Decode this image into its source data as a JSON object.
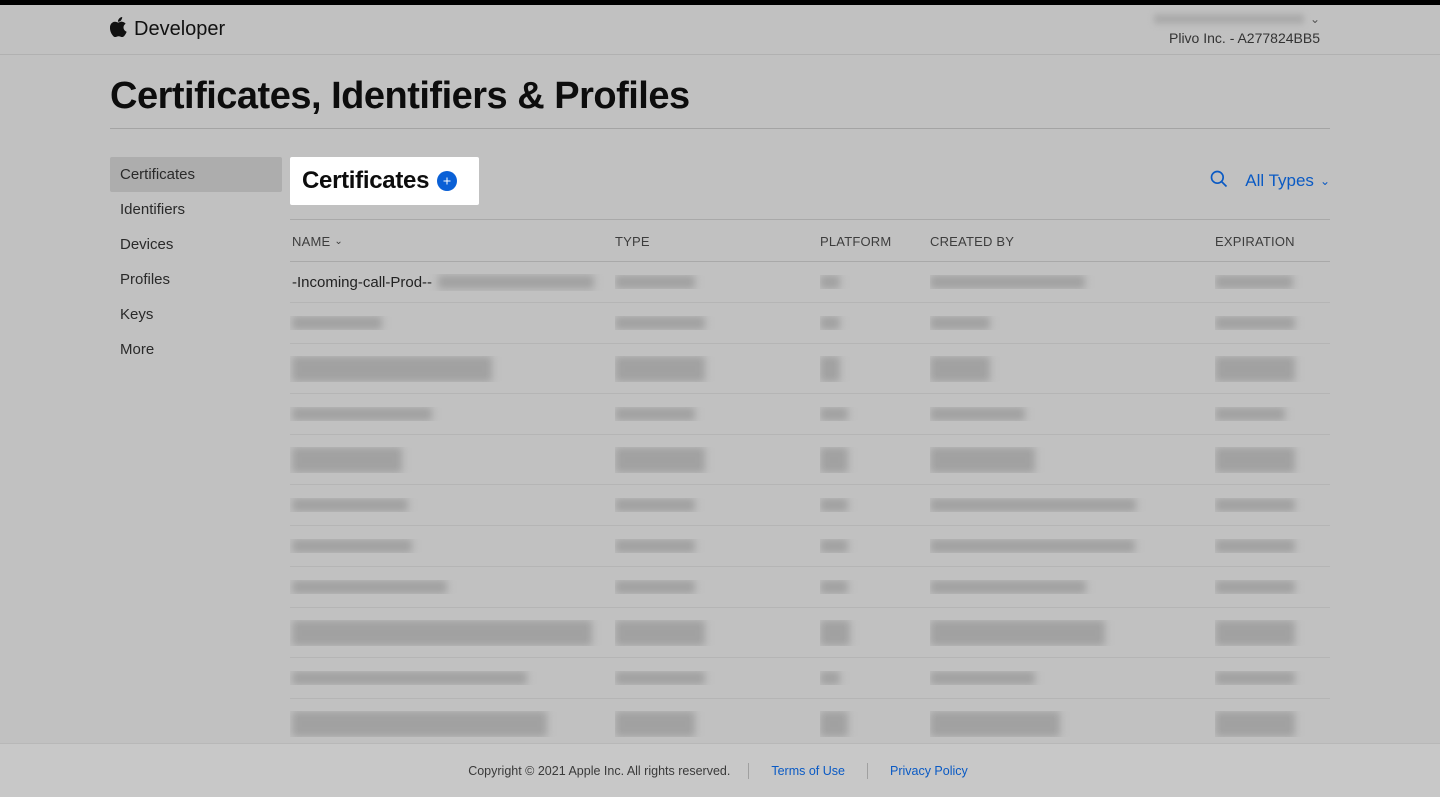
{
  "header": {
    "brand": "Developer",
    "org_line": "Plivo Inc. - A277824BB5"
  },
  "page_title": "Certificates, Identifiers & Profiles",
  "sidebar": {
    "items": [
      {
        "label": "Certificates",
        "active": true
      },
      {
        "label": "Identifiers",
        "active": false
      },
      {
        "label": "Devices",
        "active": false
      },
      {
        "label": "Profiles",
        "active": false
      },
      {
        "label": "Keys",
        "active": false
      },
      {
        "label": "More",
        "active": false
      }
    ]
  },
  "panel": {
    "title": "Certificates",
    "filter_label": "All Types"
  },
  "table": {
    "columns": {
      "name": "NAME",
      "type": "TYPE",
      "platform": "PLATFORM",
      "created_by": "CREATED BY",
      "expiration": "EXPIRATION"
    },
    "rows": [
      {
        "name_prefix": "-Incoming-call-Prod--",
        "name_w": 156,
        "type_w": 80,
        "platform_w": 20,
        "created_w": 155,
        "exp_w": 78,
        "tall": false
      },
      {
        "name_prefix": "",
        "name_w": 90,
        "type_w": 90,
        "platform_w": 20,
        "created_w": 60,
        "exp_w": 80,
        "tall": false
      },
      {
        "name_prefix": "",
        "name_w": 200,
        "type_w": 90,
        "platform_w": 20,
        "created_w": 60,
        "exp_w": 80,
        "tall": true
      },
      {
        "name_prefix": "",
        "name_w": 140,
        "type_w": 80,
        "platform_w": 28,
        "created_w": 95,
        "exp_w": 70,
        "tall": false
      },
      {
        "name_prefix": "",
        "name_w": 110,
        "type_w": 90,
        "platform_w": 28,
        "created_w": 105,
        "exp_w": 80,
        "tall": true
      },
      {
        "name_prefix": "",
        "name_w": 116,
        "type_w": 80,
        "platform_w": 28,
        "created_w": 206,
        "exp_w": 80,
        "tall": false
      },
      {
        "name_prefix": "",
        "name_w": 120,
        "type_w": 80,
        "platform_w": 28,
        "created_w": 205,
        "exp_w": 80,
        "tall": false
      },
      {
        "name_prefix": "",
        "name_w": 155,
        "type_w": 80,
        "platform_w": 28,
        "created_w": 156,
        "exp_w": 80,
        "tall": false
      },
      {
        "name_prefix": "",
        "name_w": 300,
        "type_w": 90,
        "platform_w": 30,
        "created_w": 175,
        "exp_w": 80,
        "tall": true
      },
      {
        "name_prefix": "",
        "name_w": 235,
        "type_w": 90,
        "platform_w": 20,
        "created_w": 105,
        "exp_w": 80,
        "tall": false
      },
      {
        "name_prefix": "",
        "name_w": 255,
        "type_w": 80,
        "platform_w": 28,
        "created_w": 130,
        "exp_w": 80,
        "tall": true
      },
      {
        "name_prefix": "",
        "name_w": 230,
        "type_w": 90,
        "platform_w": 28,
        "created_w": 70,
        "exp_w": 80,
        "tall": false
      }
    ]
  },
  "footer": {
    "copyright": "Copyright © 2021 Apple Inc. All rights reserved.",
    "terms": "Terms of Use",
    "privacy": "Privacy Policy"
  }
}
